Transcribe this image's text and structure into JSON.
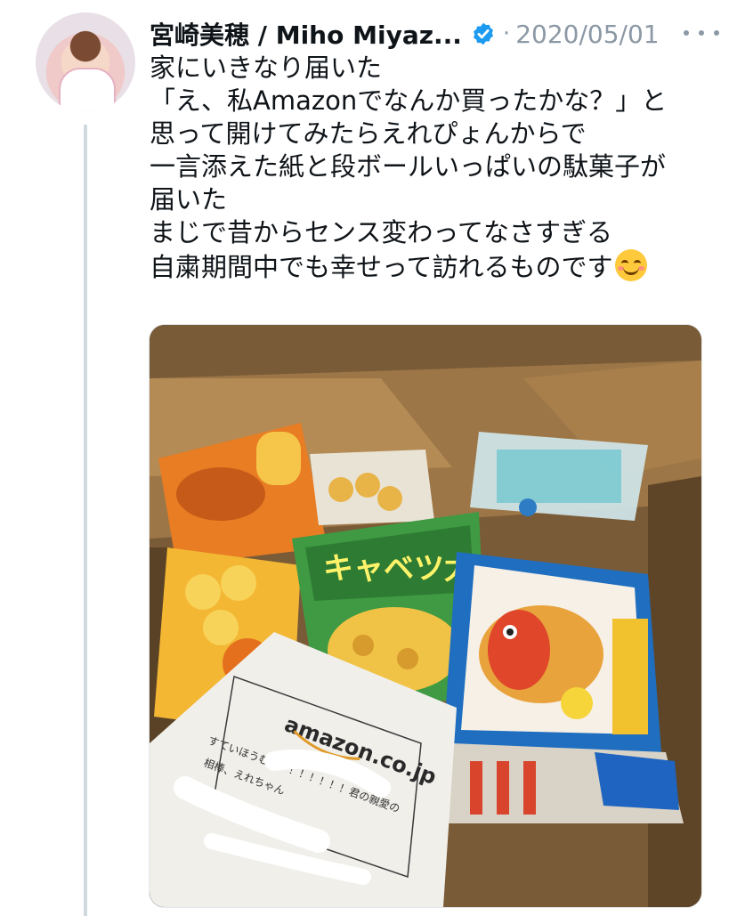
{
  "tweet": {
    "author_name": "宮崎美穂 / Miho Miyaz...",
    "separator": "·",
    "date": "2020/05/01",
    "lines": [
      "家にいきなり届いた",
      "「え、私Amazonでなんか買ったかな？」と",
      "思って開けてみたらえれぴょんからで",
      "一言添えた紙と段ボールいっぱいの駄菓子が",
      "届いた",
      "まじで昔からセンス変わってなさすぎる",
      "自粛期間中でも幸せって訪れるものです"
    ],
    "emoji": "smiling-face-emoji"
  },
  "photo": {
    "snack_labels": {
      "kyabetsu": "キャベツ太",
      "note_brand": "amazon.co.jp",
      "note_line1": "すていほうむ！！！！！！！！君の親愛の",
      "note_line2": "相棒、えれちゃん"
    }
  },
  "colors": {
    "verified": "#1d9bf0",
    "muted_text": "#8b98a5",
    "thread_line": "#cfd9de"
  }
}
